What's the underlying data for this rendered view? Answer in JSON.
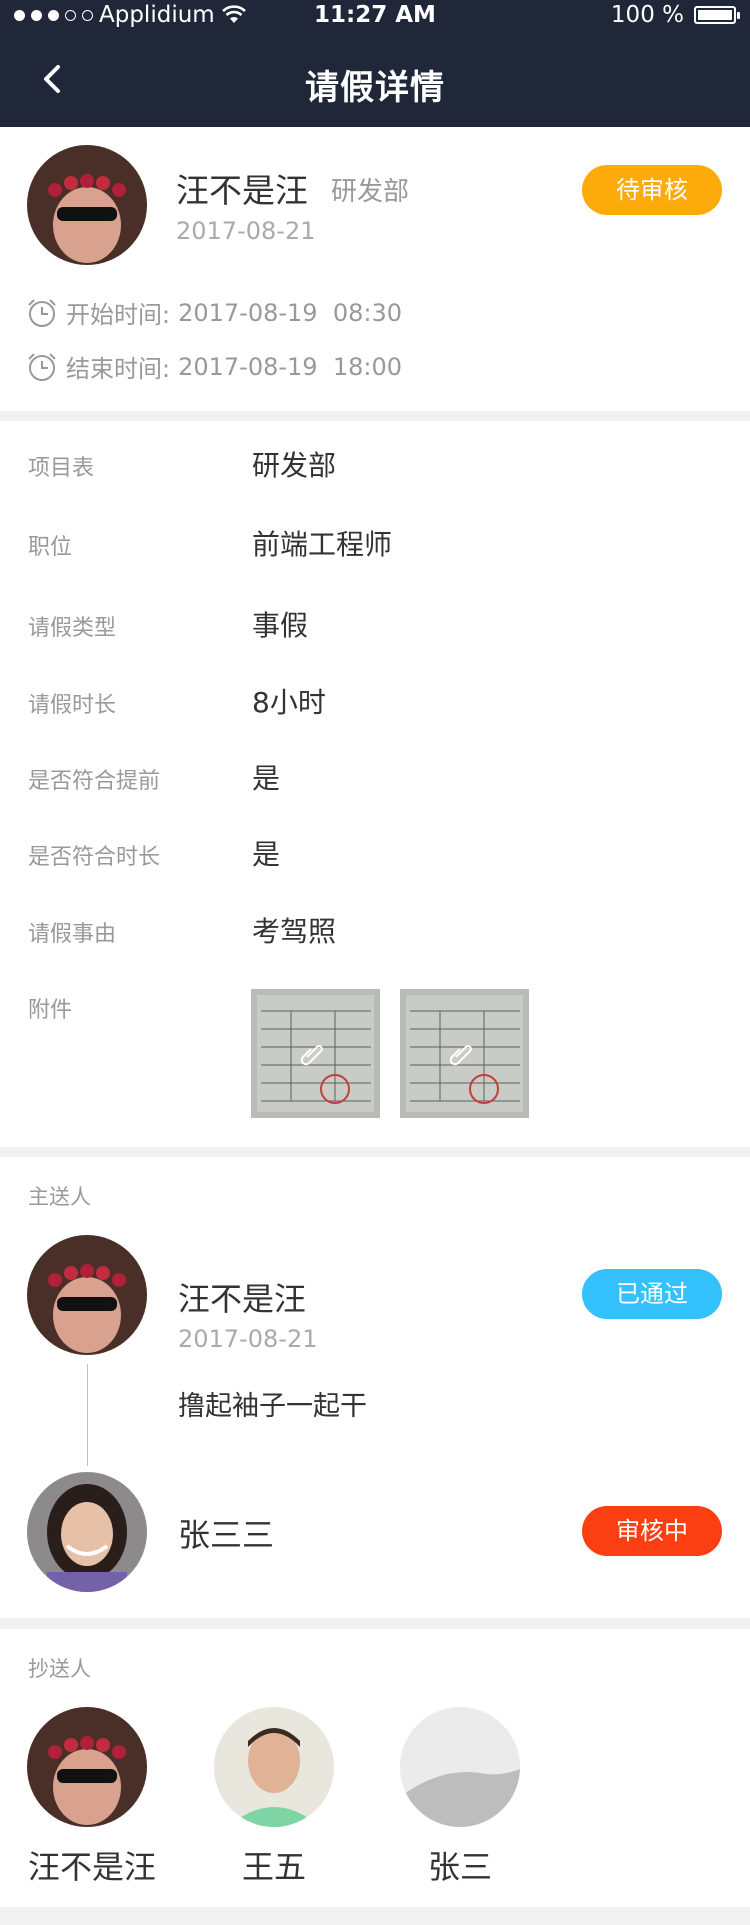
{
  "status_bar": {
    "carrier": "Applidium",
    "time": "11:27 AM",
    "battery": "100 %"
  },
  "nav": {
    "title": "请假详情"
  },
  "applicant": {
    "name": "汪不是汪",
    "department": "研发部",
    "date": "2017-08-21",
    "status": "待审核",
    "start_label": "开始时间:",
    "start_value": "2017-08-19  08:30",
    "end_label": "结束时间:",
    "end_value": "2017-08-19  18:00"
  },
  "details": [
    {
      "label": "项目表",
      "value": "研发部"
    },
    {
      "label": "职位",
      "value": "前端工程师"
    },
    {
      "label": "请假类型",
      "value": "事假"
    },
    {
      "label": "请假时长",
      "value": "8小时"
    },
    {
      "label": "是否符合提前",
      "value": "是"
    },
    {
      "label": "是否符合时长",
      "value": "是"
    },
    {
      "label": "请假事由",
      "value": "考驾照"
    }
  ],
  "attachments_label": "附件",
  "approvers": {
    "label": "主送人",
    "items": [
      {
        "name": "汪不是汪",
        "date": "2017-08-21",
        "comment": "撸起袖子一起干",
        "status": "已通过"
      },
      {
        "name": "张三三",
        "status": "审核中"
      }
    ]
  },
  "cc": {
    "label": "抄送人",
    "items": [
      {
        "name": "汪不是汪"
      },
      {
        "name": "王五"
      },
      {
        "name": "张三"
      }
    ]
  },
  "colors": {
    "header": "#1f2738",
    "pending": "#fdab0b",
    "approved": "#35c1fb",
    "reviewing": "#fb3f12"
  }
}
